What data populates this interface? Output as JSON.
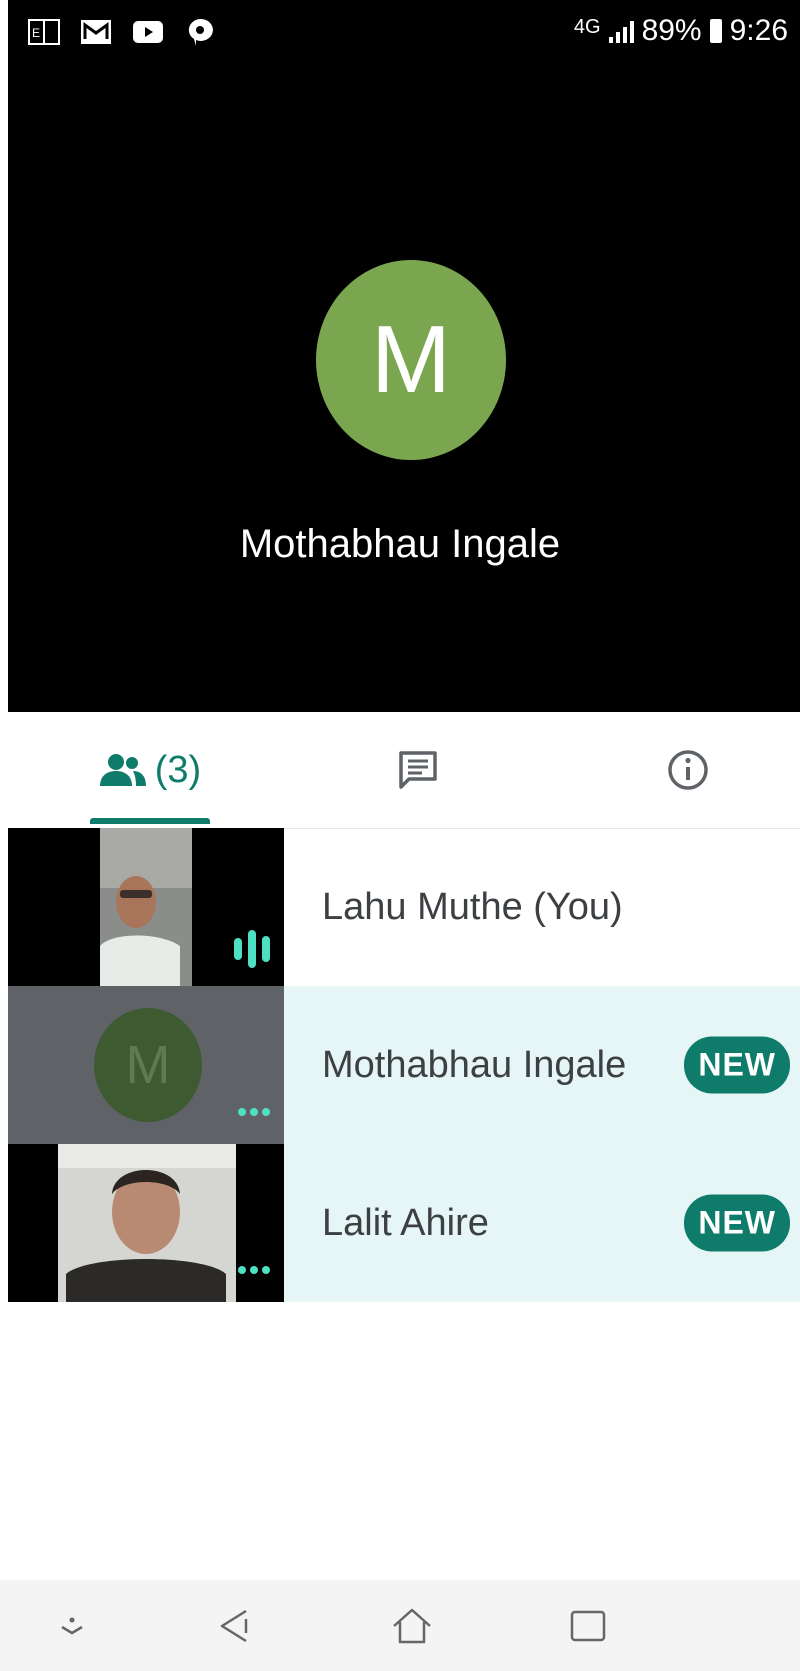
{
  "status_bar": {
    "network": "4G",
    "battery": "89%",
    "time": "9:26",
    "icons": [
      "news-icon",
      "gmail-icon",
      "youtube-icon",
      "chat-icon"
    ]
  },
  "active_speaker": {
    "initial": "M",
    "name": "Mothabhau Ingale",
    "avatar_color": "#7ba650"
  },
  "tabs": {
    "people_count": "(3)",
    "accent_color": "#0f7c6b"
  },
  "participants": [
    {
      "name": "Lahu Muthe (You)",
      "badge": ""
    },
    {
      "name": "Mothabhau Ingale",
      "initial": "M",
      "badge": "NEW"
    },
    {
      "name": "Lalit Ahire",
      "badge": "NEW"
    }
  ],
  "colors": {
    "highlight_row": "#e6f5f5",
    "badge": "#0f7c6b",
    "indicator": "#4ee0c2"
  }
}
